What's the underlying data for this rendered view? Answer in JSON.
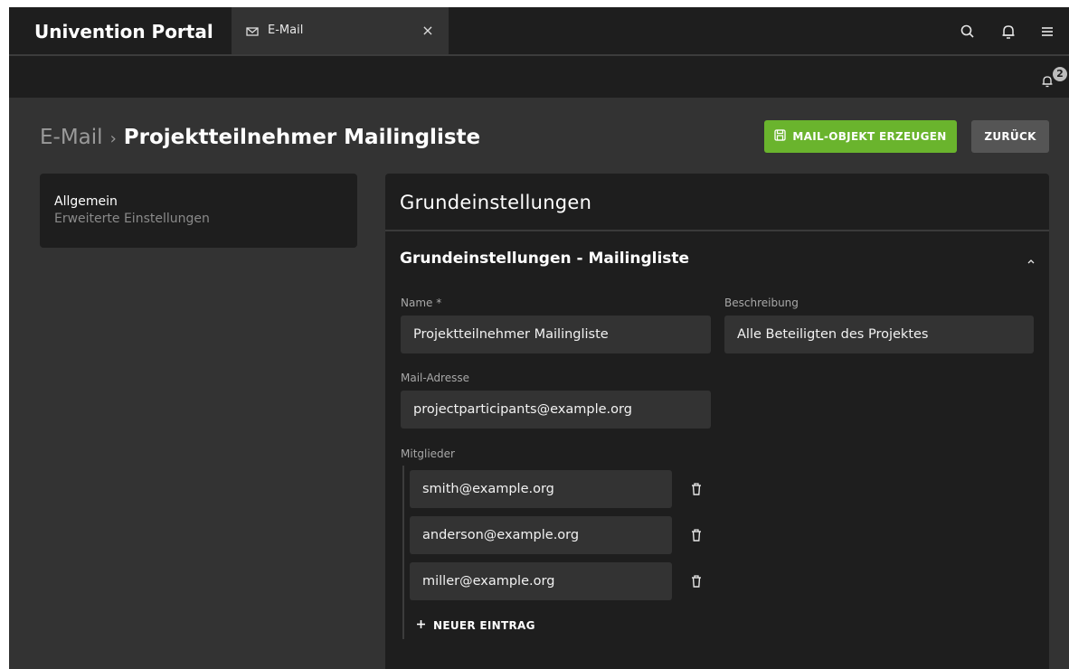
{
  "header": {
    "brand": "Univention Portal",
    "tab": {
      "label": "E-Mail",
      "icon": "mail-icon",
      "close": "×"
    },
    "icons": [
      "search-icon",
      "bell-icon",
      "menu-icon"
    ]
  },
  "notifications": {
    "count": "2",
    "icon": "bell-icon"
  },
  "breadcrumb": {
    "parent": "E-Mail",
    "separator": "›",
    "current": "Projektteilnehmer Mailingliste"
  },
  "actions": {
    "create_label": "MAIL-OBJEKT ERZEUGEN",
    "create_icon": "save-icon",
    "back_label": "ZURÜCK",
    "accent_color": "#6ab42d"
  },
  "sidebar": {
    "items": [
      {
        "label": "Allgemein",
        "active": true
      },
      {
        "label": "Erweiterte Einstellungen",
        "active": false
      }
    ]
  },
  "panel": {
    "title": "Grundeinstellungen",
    "section": {
      "title": "Grundeinstellungen - Mailingliste",
      "fields": {
        "name": {
          "label": "Name *",
          "value": "Projektteilnehmer Mailingliste"
        },
        "description": {
          "label": "Beschreibung",
          "value": "Alle Beteiligten des Projektes"
        },
        "mail": {
          "label": "Mail-Adresse",
          "value": "projectparticipants@example.org"
        }
      },
      "members": {
        "label": "Mitglieder",
        "entries": [
          "smith@example.org",
          "anderson@example.org",
          "miller@example.org"
        ],
        "add_label": "NEUER EINTRAG"
      }
    }
  }
}
